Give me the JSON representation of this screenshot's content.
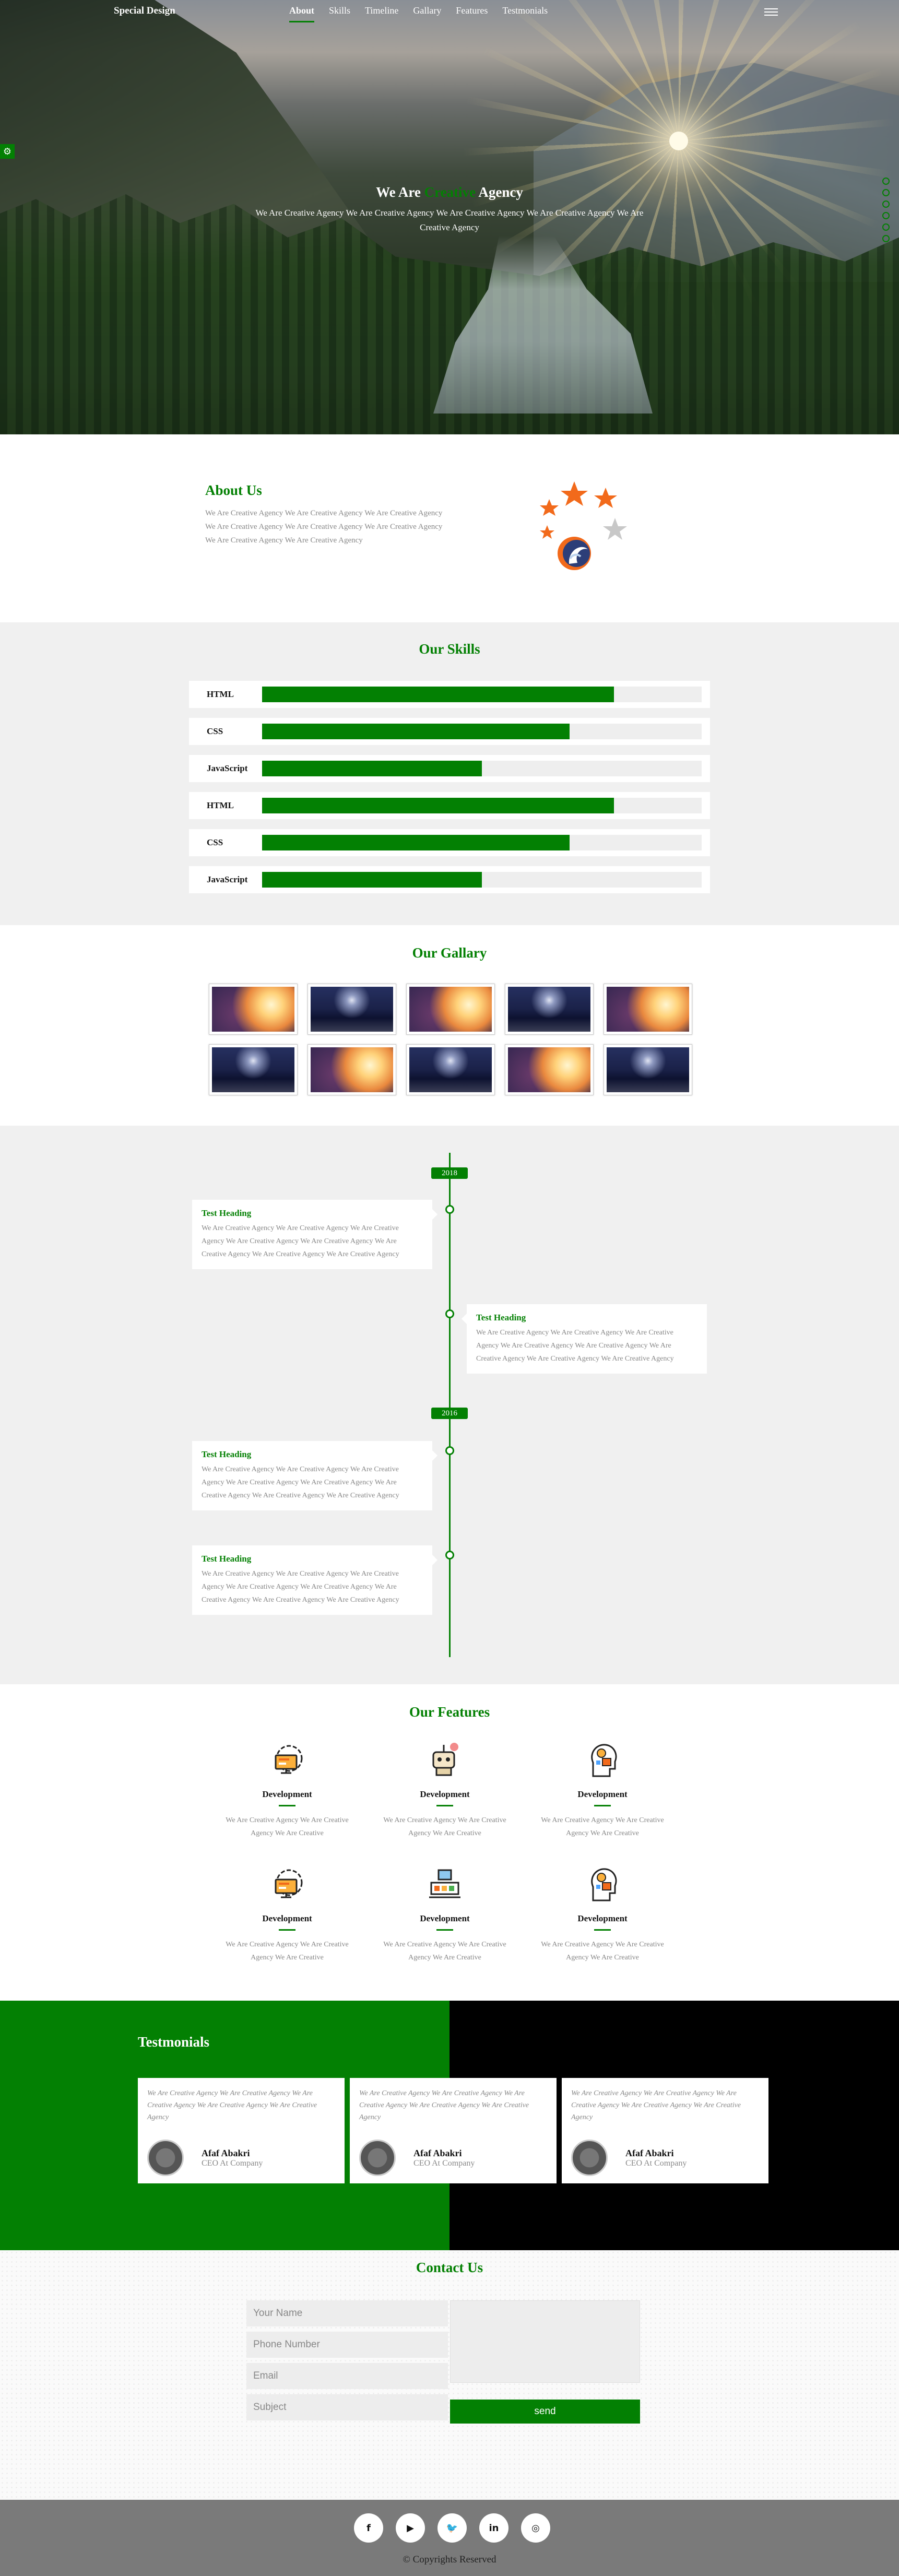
{
  "nav": {
    "brand": "Special Design",
    "links": [
      "About",
      "Skills",
      "Timeline",
      "Gallary",
      "Features",
      "Testmonials"
    ],
    "active": "About"
  },
  "hero": {
    "title_pre": "We Are ",
    "title_highlight": "Creative",
    "title_post": " Agency",
    "subtitle": "We Are Creative Agency We Are Creative Agency We Are Creative Agency We Are Creative Agency We Are Creative Agency"
  },
  "about": {
    "title": "About Us",
    "text": "We Are Creative Agency We Are Creative Agency We Are Creative Agency We Are Creative Agency We Are Creative Agency We Are Creative Agency We Are Creative Agency We Are Creative Agency"
  },
  "skills": {
    "title": "Our Skills",
    "items": [
      {
        "label": "HTML",
        "level": 0.8
      },
      {
        "label": "CSS",
        "level": 0.7
      },
      {
        "label": "JavaScript",
        "level": 0.5
      },
      {
        "label": "HTML",
        "level": 0.8
      },
      {
        "label": "CSS",
        "level": 0.7
      },
      {
        "label": "JavaScript",
        "level": 0.5
      }
    ]
  },
  "gallery": {
    "title": "Our Gallary",
    "images": [
      "sunset",
      "city",
      "sunset",
      "city",
      "sunset",
      "city",
      "sunset",
      "city",
      "sunset",
      "city"
    ]
  },
  "timeline": {
    "years": [
      "2018",
      "2016"
    ],
    "items": [
      {
        "heading": "Test Heading",
        "text": "We Are Creative Agency We Are Creative Agency We Are Creative Agency We Are Creative Agency We Are Creative Agency We Are Creative Agency We Are Creative Agency We Are Creative Agency"
      },
      {
        "heading": "Test Heading",
        "text": "We Are Creative Agency We Are Creative Agency We Are Creative Agency We Are Creative Agency We Are Creative Agency We Are Creative Agency We Are Creative Agency We Are Creative Agency"
      },
      {
        "heading": "Test Heading",
        "text": "We Are Creative Agency We Are Creative Agency We Are Creative Agency We Are Creative Agency We Are Creative Agency We Are Creative Agency We Are Creative Agency We Are Creative Agency"
      },
      {
        "heading": "Test Heading",
        "text": "We Are Creative Agency We Are Creative Agency We Are Creative Agency We Are Creative Agency We Are Creative Agency We Are Creative Agency We Are Creative Agency We Are Creative Agency"
      }
    ]
  },
  "features": {
    "title": "Our Features",
    "items": [
      {
        "title": "Development",
        "text": "We Are Creative Agency We Are Creative Agency We Are Creative"
      },
      {
        "title": "Development",
        "text": "We Are Creative Agency We Are Creative Agency We Are Creative"
      },
      {
        "title": "Development",
        "text": "We Are Creative Agency We Are Creative Agency We Are Creative"
      },
      {
        "title": "Development",
        "text": "We Are Creative Agency We Are Creative Agency We Are Creative"
      },
      {
        "title": "Development",
        "text": "We Are Creative Agency We Are Creative Agency We Are Creative"
      },
      {
        "title": "Development",
        "text": "We Are Creative Agency We Are Creative Agency We Are Creative"
      }
    ]
  },
  "testimonials": {
    "title": "Testmonials",
    "items": [
      {
        "quote": "We Are Creative Agency We Are Creative Agency We Are Creative Agency We Are Creative Agency We Are Creative Agency",
        "name": "Afaf Abakri",
        "role": "CEO At Company"
      },
      {
        "quote": "We Are Creative Agency We Are Creative Agency We Are Creative Agency We Are Creative Agency We Are Creative Agency",
        "name": "Afaf Abakri",
        "role": "CEO At Company"
      },
      {
        "quote": "We Are Creative Agency We Are Creative Agency We Are Creative Agency We Are Creative Agency We Are Creative Agency",
        "name": "Afaf Abakri",
        "role": "CEO At Company"
      }
    ]
  },
  "contact": {
    "title": "Contact Us",
    "name_placeholder": "Your Name",
    "phone_placeholder": "Phone Number",
    "email_placeholder": "Email",
    "subject_placeholder": "Subject",
    "send_label": "send"
  },
  "footer": {
    "socials": [
      "facebook-icon",
      "youtube-icon",
      "twitter-icon",
      "linkedin-icon",
      "instagram-icon"
    ],
    "copyright": "© Copyrights Reserved"
  },
  "colors": {
    "accent": "#038003",
    "light_bg": "#f0f0f0",
    "dark": "#000000"
  }
}
